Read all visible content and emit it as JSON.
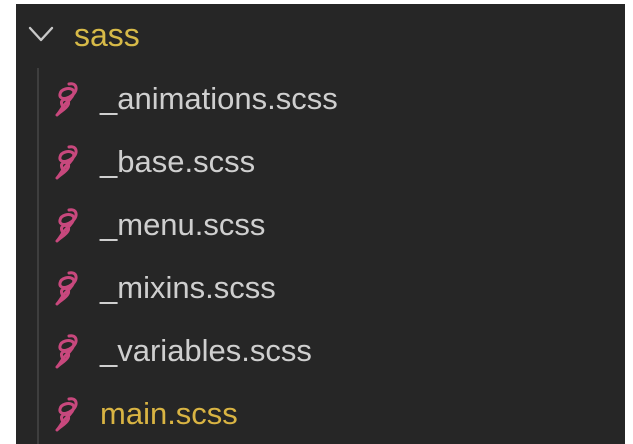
{
  "explorer": {
    "folder": {
      "name": "sass",
      "expanded": true,
      "icon": "chevron-down-icon",
      "color": "#d7ba48"
    },
    "files": [
      {
        "name": "_animations.scss",
        "icon": "sass-file-icon",
        "modified": false
      },
      {
        "name": "_base.scss",
        "icon": "sass-file-icon",
        "modified": false
      },
      {
        "name": "_menu.scss",
        "icon": "sass-file-icon",
        "modified": false
      },
      {
        "name": "_mixins.scss",
        "icon": "sass-file-icon",
        "modified": false
      },
      {
        "name": "_variables.scss",
        "icon": "sass-file-icon",
        "modified": false
      },
      {
        "name": "main.scss",
        "icon": "sass-file-icon",
        "modified": true
      }
    ],
    "colors": {
      "background": "#262626",
      "text": "#cfcfcf",
      "modified_text": "#d9b443",
      "sass_icon": "#c8487d"
    }
  }
}
